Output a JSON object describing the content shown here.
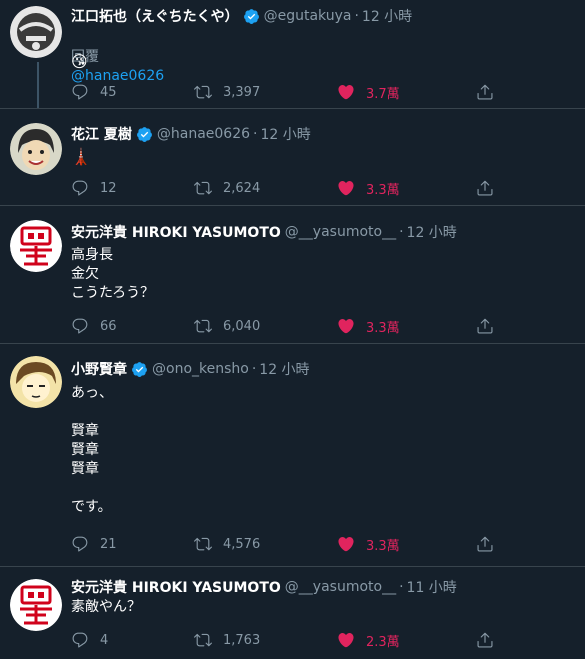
{
  "tweets": [
    {
      "name": "江口拓也（えぐちたくや）",
      "verified": true,
      "handle": "@egutakuya",
      "time": "12 小時",
      "reply_prefix": "回覆",
      "reply_to": "@hanae0626",
      "text": "😘",
      "replies": "45",
      "retweets": "3,397",
      "likes": "3.7萬"
    },
    {
      "name": "花江 夏樹",
      "verified": true,
      "handle": "@hanae0626",
      "time": "12 小時",
      "text": "🗼",
      "replies": "12",
      "retweets": "2,624",
      "likes": "3.3萬"
    },
    {
      "name": "安元洋貴 HIROKI YASUMOTO",
      "verified": false,
      "handle": "@__yasumoto__",
      "time": "12 小時",
      "text": "高身長\n金欠\nこうたろう？",
      "replies": "66",
      "retweets": "6,040",
      "likes": "3.3萬"
    },
    {
      "name": "小野賢章",
      "verified": true,
      "handle": "@ono_kensho",
      "time": "12 小時",
      "text": "あっ、\n\n賢章\n賢章\n賢章\n\nです。",
      "replies": "21",
      "retweets": "4,576",
      "likes": "3.3萬"
    },
    {
      "name": "安元洋貴 HIROKI YASUMOTO",
      "verified": false,
      "handle": "@__yasumoto__",
      "time": "11 小時",
      "text": "素敵やん？",
      "replies": "4",
      "retweets": "1,763",
      "likes": "2.3萬"
    }
  ],
  "colors": {
    "background": "#15202b",
    "divider": "#38444d",
    "secondary_text": "#8899a6",
    "link": "#1da1f2",
    "like": "#e0245e",
    "verified": "#1da1f2"
  },
  "separator": "·"
}
